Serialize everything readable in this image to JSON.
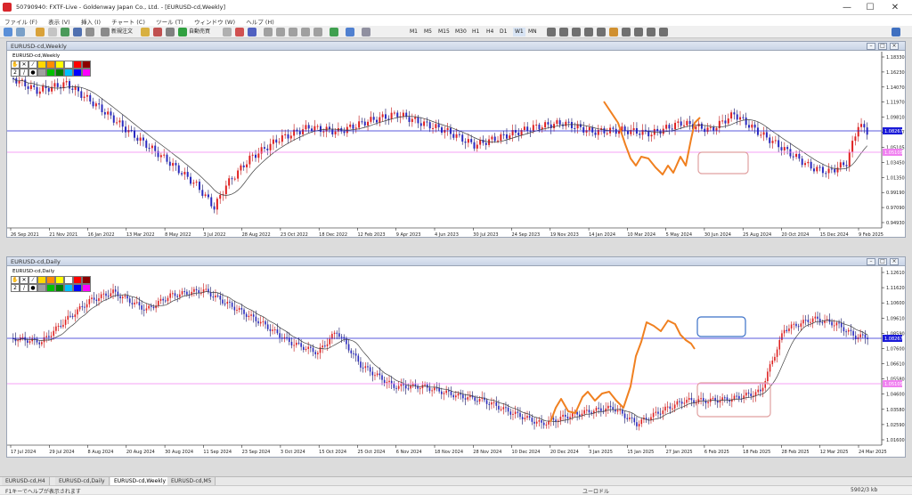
{
  "window": {
    "title": "50790940: FXTF-Live - Goldenway Japan Co., Ltd. - [EURUSD-cd,Weekly]",
    "buttons": {
      "minimize": "—",
      "maximize": "☐",
      "close": "✕"
    }
  },
  "menu": [
    "ファイル (F)",
    "表示 (V)",
    "挿入 (I)",
    "チャート (C)",
    "ツール (T)",
    "ウィンドウ (W)",
    "ヘルプ (H)"
  ],
  "toolbar": {
    "new_order": "新規注文",
    "auto_trade": "自動売買",
    "timeframes": [
      "M1",
      "M5",
      "M15",
      "M30",
      "H1",
      "H4",
      "D1",
      "W1",
      "MN"
    ]
  },
  "weekly_chart": {
    "caption": "EURUSD-cd,Weekly",
    "symbol_label": "EURUSD-cd,Weekly",
    "price_box": "1.08267",
    "pink_box": "1.05105",
    "price_labels": [
      "1.18330",
      "1.16230",
      "1.14070",
      "1.11970",
      "1.09810",
      "1.08267",
      "1.05105",
      "1.03450",
      "1.01350",
      "0.99190",
      "0.97090",
      "0.94930"
    ],
    "date_labels": [
      "26 Sep 2021",
      "21 Nov 2021",
      "16 Jan 2022",
      "13 Mar 2022",
      "8 May 2022",
      "3 Jul 2022",
      "28 Aug 2022",
      "23 Oct 2022",
      "18 Dec 2022",
      "12 Feb 2023",
      "9 Apr 2023",
      "4 Jun 2023",
      "30 Jul 2023",
      "24 Sep 2023",
      "19 Nov 2023",
      "14 Jan 2024",
      "10 Mar 2024",
      "5 May 2024",
      "30 Jun 2024",
      "25 Aug 2024",
      "20 Oct 2024",
      "15 Dec 2024",
      "9 Feb 2025"
    ],
    "line_colors": {
      "price": "#2020d0",
      "support": "#f080f0",
      "ma": "#404040",
      "wave": "#f08020",
      "target": "#e0a0a0"
    }
  },
  "daily_chart": {
    "caption": "EURUSD-cd,Daily",
    "symbol_label": "EURUSD-cd,Daily",
    "price_box": "1.08267",
    "pink_box": "1.05105",
    "price_labels": [
      "1.12610",
      "1.11620",
      "1.10600",
      "1.09610",
      "1.08590",
      "1.07600",
      "1.06610",
      "1.05580",
      "1.04600",
      "1.03580",
      "1.02590",
      "1.01600"
    ],
    "date_labels": [
      "17 Jul 2024",
      "29 Jul 2024",
      "8 Aug 2024",
      "20 Aug 2024",
      "30 Aug 2024",
      "11 Sep 2024",
      "23 Sep 2024",
      "3 Oct 2024",
      "15 Oct 2024",
      "25 Oct 2024",
      "6 Nov 2024",
      "18 Nov 2024",
      "28 Nov 2024",
      "10 Dec 2024",
      "20 Dec 2024",
      "3 Jan 2025",
      "15 Jan 2025",
      "27 Jan 2025",
      "6 Feb 2025",
      "18 Feb 2025",
      "28 Feb 2025",
      "12 Mar 2025",
      "24 Mar 2025"
    ]
  },
  "tabs": [
    "EURUSD-cd,H4",
    "EURUSD-cd,Daily",
    "EURUSD-cd,Weekly",
    "EURUSD-cd,M5"
  ],
  "status": {
    "help": "F1キーでヘルプが表示されます",
    "profile": "ユーロドル",
    "traffic": "5902/3 kb"
  }
}
